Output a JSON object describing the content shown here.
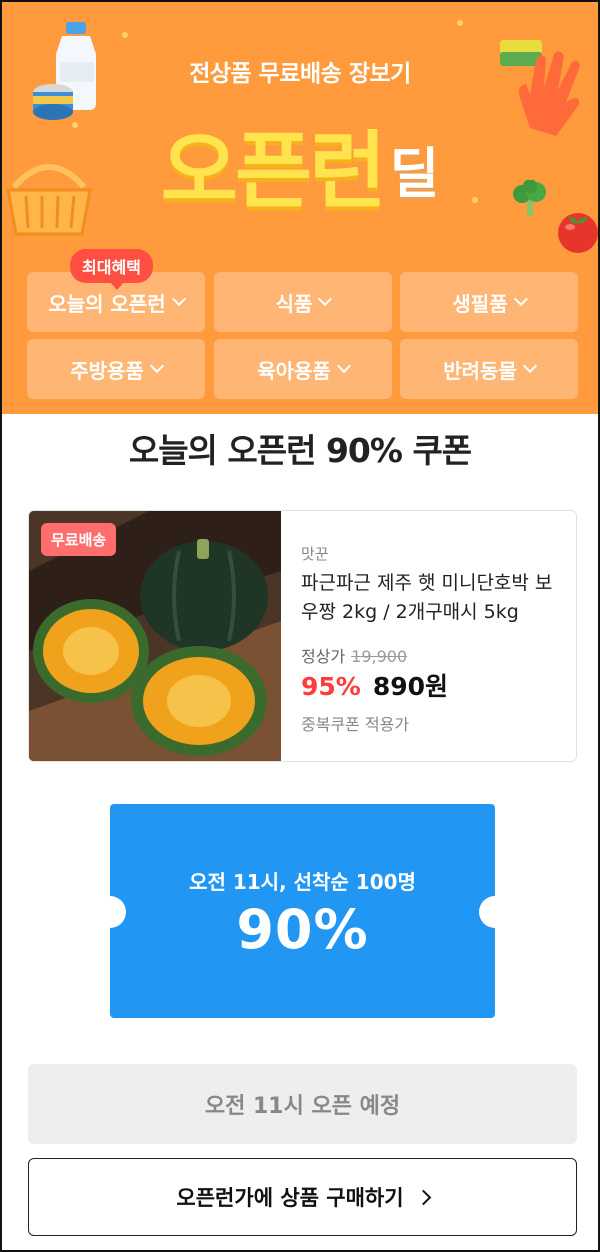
{
  "banner": {
    "subtitle": "전상품 무료배송 장보기",
    "title_main": "오픈런",
    "title_deal": "딜",
    "badge_max": "최대혜택",
    "bg_color": "#ff9a3d"
  },
  "categories": [
    {
      "label": "오늘의 오픈런",
      "icon": "chevron-down-icon"
    },
    {
      "label": "식품",
      "icon": "chevron-down-icon"
    },
    {
      "label": "생필품",
      "icon": "chevron-down-icon"
    },
    {
      "label": "주방용품",
      "icon": "chevron-down-icon"
    },
    {
      "label": "육아용품",
      "icon": "chevron-down-icon"
    },
    {
      "label": "반려동물",
      "icon": "chevron-down-icon"
    }
  ],
  "headline": "오늘의 오픈런 90% 쿠폰",
  "product": {
    "badge": "무료배송",
    "brand": "맛꾼",
    "name": "파근파근 제주 햇 미니단호박 보우짱 2kg / 2개구매시 5kg",
    "original_label": "정상가",
    "original_price": "19,900",
    "discount": "95%",
    "price": "890원",
    "coupon_note": "중복쿠폰 적용가"
  },
  "ticket": {
    "subtitle": "오전 11시, 선착순 100명",
    "percent": "90%",
    "color": "#2196f3"
  },
  "open_button": "오전 11시 오픈 예정",
  "buy_button": "오픈런가에 상품 구매하기"
}
